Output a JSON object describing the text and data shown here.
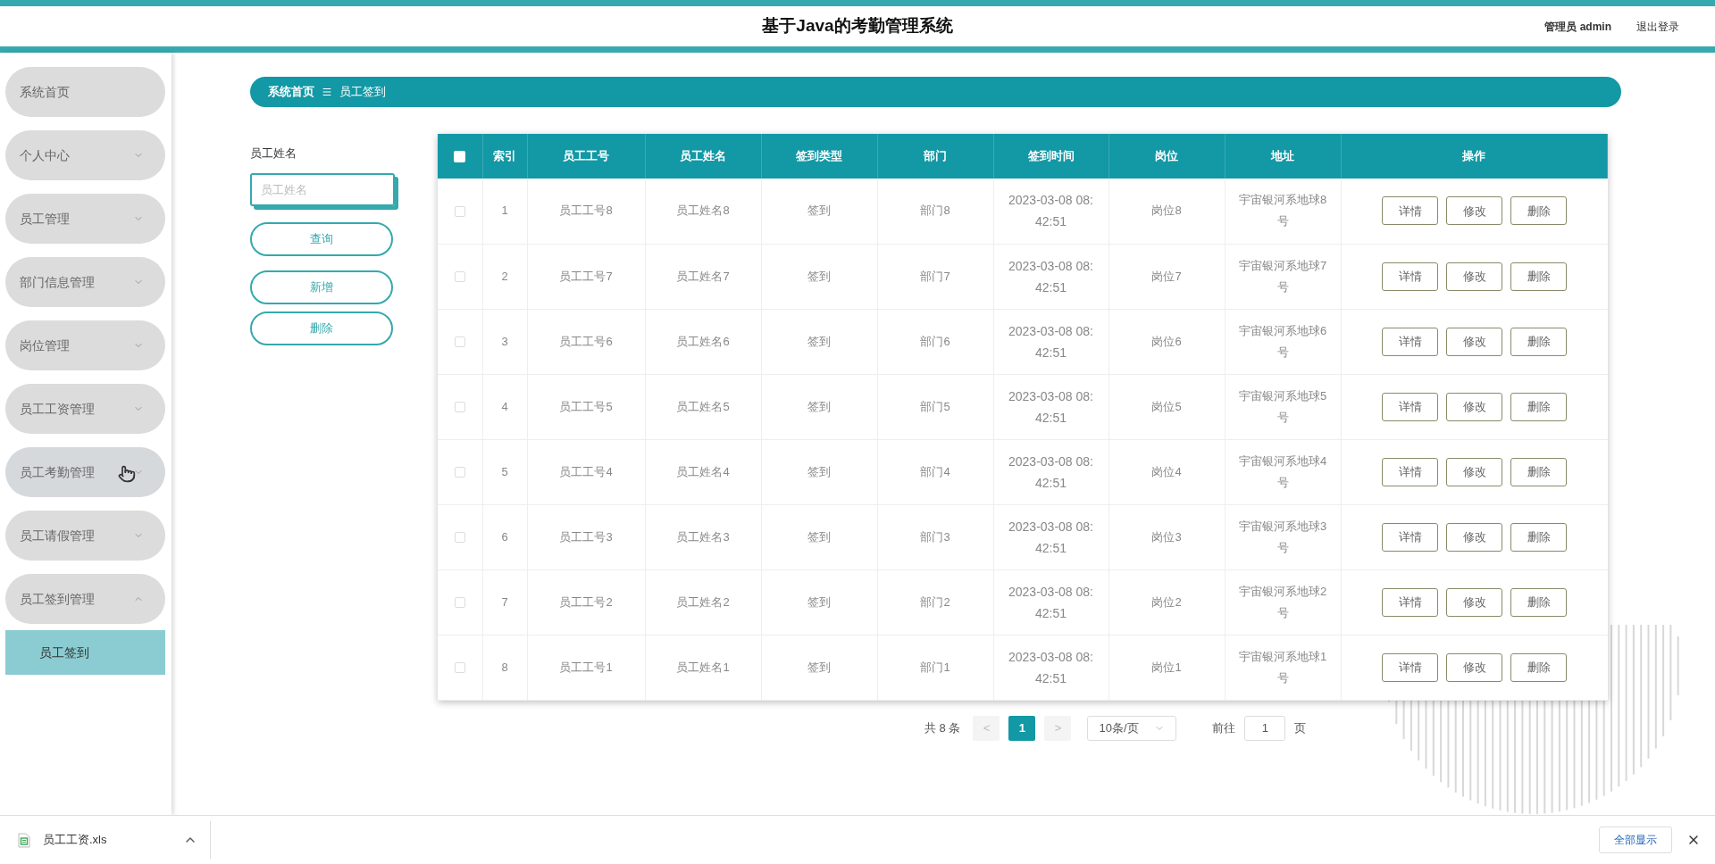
{
  "header": {
    "title": "基于Java的考勤管理系统",
    "user": "管理员 admin",
    "logout": "退出登录"
  },
  "sidebar": {
    "items": [
      {
        "label": "系统首页",
        "has_children": false,
        "hovered": false
      },
      {
        "label": "个人中心",
        "has_children": true,
        "expanded": false,
        "hovered": false
      },
      {
        "label": "员工管理",
        "has_children": true,
        "expanded": false,
        "hovered": false
      },
      {
        "label": "部门信息管理",
        "has_children": true,
        "expanded": false,
        "hovered": false
      },
      {
        "label": "岗位管理",
        "has_children": true,
        "expanded": false,
        "hovered": false
      },
      {
        "label": "员工工资管理",
        "has_children": true,
        "expanded": false,
        "hovered": false
      },
      {
        "label": "员工考勤管理",
        "has_children": true,
        "expanded": false,
        "hovered": true
      },
      {
        "label": "员工请假管理",
        "has_children": true,
        "expanded": false,
        "hovered": false
      },
      {
        "label": "员工签到管理",
        "has_children": true,
        "expanded": true,
        "hovered": false,
        "children": [
          {
            "label": "员工签到",
            "selected": true
          }
        ]
      }
    ]
  },
  "breadcrumb": [
    "系统首页",
    "员工签到"
  ],
  "search": {
    "label": "员工姓名",
    "placeholder": "员工姓名",
    "buttons": [
      "查询",
      "新增",
      "删除"
    ]
  },
  "table": {
    "select_all_checked": false,
    "columns": [
      "索引",
      "员工工号",
      "员工姓名",
      "签到类型",
      "部门",
      "签到时间",
      "岗位",
      "地址",
      "操作"
    ],
    "rows": [
      {
        "checked": false,
        "cells": [
          "1",
          "员工工号8",
          "员工姓名8",
          "签到",
          "部门8",
          "2023-03-08 08:42:51",
          "岗位8",
          "宇宙银河系地球8号"
        ],
        "actions": [
          "详情",
          "修改",
          "删除"
        ]
      },
      {
        "checked": false,
        "cells": [
          "2",
          "员工工号7",
          "员工姓名7",
          "签到",
          "部门7",
          "2023-03-08 08:42:51",
          "岗位7",
          "宇宙银河系地球7号"
        ],
        "actions": [
          "详情",
          "修改",
          "删除"
        ]
      },
      {
        "checked": false,
        "cells": [
          "3",
          "员工工号6",
          "员工姓名6",
          "签到",
          "部门6",
          "2023-03-08 08:42:51",
          "岗位6",
          "宇宙银河系地球6号"
        ],
        "actions": [
          "详情",
          "修改",
          "删除"
        ]
      },
      {
        "checked": false,
        "cells": [
          "4",
          "员工工号5",
          "员工姓名5",
          "签到",
          "部门5",
          "2023-03-08 08:42:51",
          "岗位5",
          "宇宙银河系地球5号"
        ],
        "actions": [
          "详情",
          "修改",
          "删除"
        ]
      },
      {
        "checked": false,
        "cells": [
          "5",
          "员工工号4",
          "员工姓名4",
          "签到",
          "部门4",
          "2023-03-08 08:42:51",
          "岗位4",
          "宇宙银河系地球4号"
        ],
        "actions": [
          "详情",
          "修改",
          "删除"
        ]
      },
      {
        "checked": false,
        "cells": [
          "6",
          "员工工号3",
          "员工姓名3",
          "签到",
          "部门3",
          "2023-03-08 08:42:51",
          "岗位3",
          "宇宙银河系地球3号"
        ],
        "actions": [
          "详情",
          "修改",
          "删除"
        ]
      },
      {
        "checked": false,
        "cells": [
          "7",
          "员工工号2",
          "员工姓名2",
          "签到",
          "部门2",
          "2023-03-08 08:42:51",
          "岗位2",
          "宇宙银河系地球2号"
        ],
        "actions": [
          "详情",
          "修改",
          "删除"
        ]
      },
      {
        "checked": false,
        "cells": [
          "8",
          "员工工号1",
          "员工姓名1",
          "签到",
          "部门1",
          "2023-03-08 08:42:51",
          "岗位1",
          "宇宙银河系地球1号"
        ],
        "actions": [
          "详情",
          "修改",
          "删除"
        ]
      }
    ]
  },
  "pagination": {
    "total": "共 8 条",
    "prev": "<",
    "pages": [
      {
        "label": "1",
        "selected": true
      }
    ],
    "next": ">",
    "page_size": "10条/页",
    "goto": "前往",
    "goto_value": "1",
    "page_unit": "页"
  },
  "downloads": {
    "file": "员工工资.xls",
    "show_all": "全部显示"
  }
}
